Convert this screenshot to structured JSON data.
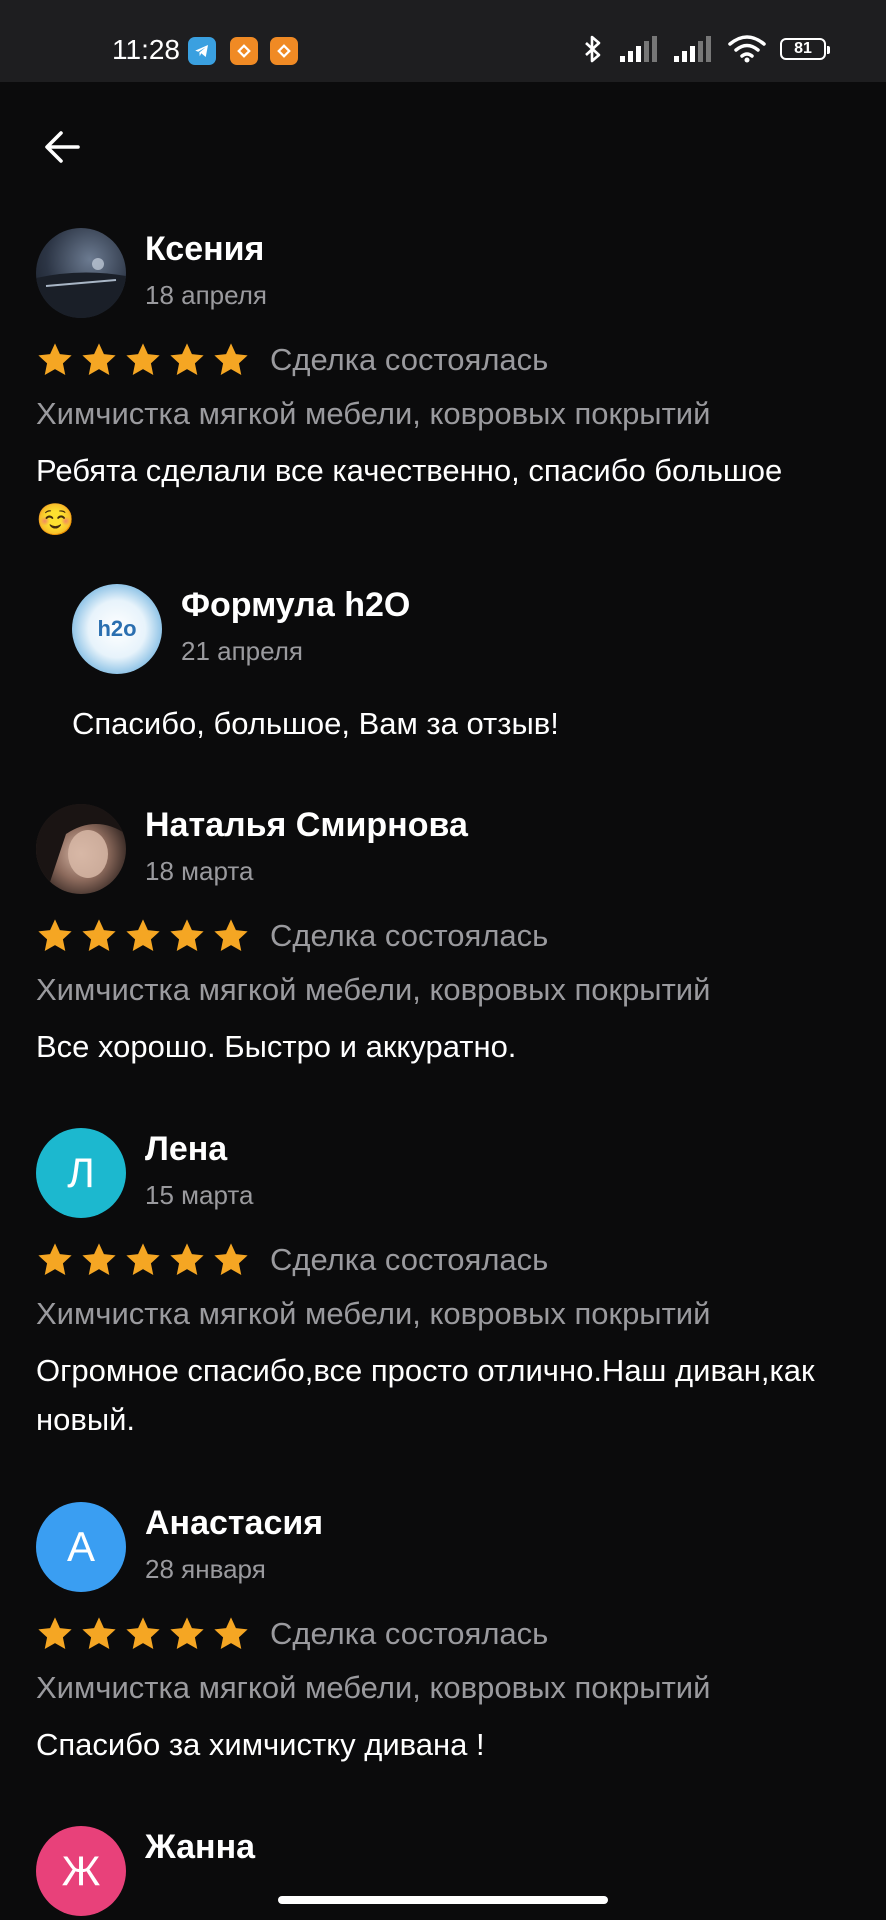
{
  "status_bar": {
    "time": "11:28",
    "battery": "81"
  },
  "reviews": [
    {
      "author": "Ксения",
      "date": "18 апреля",
      "rating": 5,
      "deal_status": "Сделка состоялась",
      "service": "Химчистка мягкой мебели, ковровых покрытий",
      "text": "Ребята сделали все качественно, спасибо большое ☺️",
      "reply": {
        "author": "Формула h2O",
        "date": "21 апреля",
        "text": "Спасибо, большое, Вам за отзыв!",
        "avatar_text": "h2o"
      }
    },
    {
      "author": "Наталья Смирнова",
      "date": "18 марта",
      "rating": 5,
      "deal_status": "Сделка состоялась",
      "service": "Химчистка мягкой мебели, ковровых покрытий",
      "text": "Все хорошо. Быстро и аккуратно."
    },
    {
      "author": "Лена",
      "date": "15 марта",
      "rating": 5,
      "deal_status": "Сделка состоялась",
      "service": "Химчистка мягкой мебели, ковровых покрытий",
      "text": "Огромное спасибо,все просто отлично.Наш диван,как новый.",
      "avatar_letter": "Л",
      "avatar_color": "#1cb8cf"
    },
    {
      "author": "Анастасия",
      "date": "28 января",
      "rating": 5,
      "deal_status": "Сделка состоялась",
      "service": "Химчистка мягкой мебели, ковровых покрытий",
      "text": "Спасибо за химчистку дивана !",
      "avatar_letter": "А",
      "avatar_color": "#3a9ef2"
    },
    {
      "author": "Жанна",
      "avatar_letter": "Ж",
      "avatar_color": "#e8417a"
    }
  ],
  "colors": {
    "star": "#f5a623",
    "muted_text": "#9a9a9e",
    "background": "#0b0b0c"
  }
}
